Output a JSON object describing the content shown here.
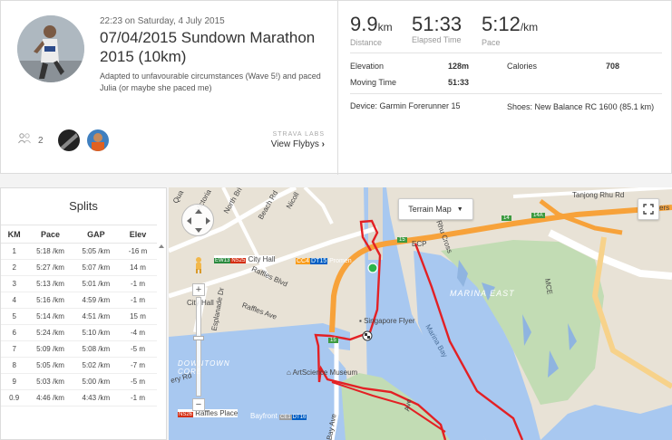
{
  "activity": {
    "timestamp": "22:23 on Saturday, 4 July 2015",
    "title": "07/04/2015 Sundown Marathon 2015 (10km)",
    "description": "Adapted to unfavourable circumstances (Wave 5!) and paced Julia (or maybe she paced me)"
  },
  "kudos": {
    "count": "2"
  },
  "flyby": {
    "lab_label": "STRAVA LABS",
    "link_label": "View Flybys"
  },
  "stats": {
    "distance": {
      "value": "9.9",
      "unit": "km",
      "label": "Distance"
    },
    "elapsed": {
      "value": "51:33",
      "label": "Elapsed Time"
    },
    "pace": {
      "value": "5:12",
      "unit": "/km",
      "label": "Pace"
    }
  },
  "details": {
    "elevation_label": "Elevation",
    "elevation_value": "128m",
    "calories_label": "Calories",
    "calories_value": "708",
    "moving_label": "Moving Time",
    "moving_value": "51:33",
    "device": "Device: Garmin Forerunner 15",
    "shoes": "Shoes: New Balance RC 1600 (85.1 km)"
  },
  "splits": {
    "title": "Splits",
    "headers": [
      "KM",
      "Pace",
      "GAP",
      "Elev"
    ],
    "rows": [
      [
        "1",
        "5:18 /km",
        "5:05 /km",
        "-16 m"
      ],
      [
        "2",
        "5:27 /km",
        "5:07 /km",
        "14 m"
      ],
      [
        "3",
        "5:13 /km",
        "5:01 /km",
        "-1 m"
      ],
      [
        "4",
        "5:16 /km",
        "4:59 /km",
        "-1 m"
      ],
      [
        "5",
        "5:14 /km",
        "4:51 /km",
        "15 m"
      ],
      [
        "6",
        "5:24 /km",
        "5:10 /km",
        "-4 m"
      ],
      [
        "7",
        "5:09 /km",
        "5:08 /km",
        "-5 m"
      ],
      [
        "8",
        "5:05 /km",
        "5:02 /km",
        "-7 m"
      ],
      [
        "9",
        "5:03 /km",
        "5:00 /km",
        "-5 m"
      ],
      [
        "0.9",
        "4:46 /km",
        "4:43 /km",
        "-1 m"
      ]
    ]
  },
  "map": {
    "map_type_label": "Terrain Map",
    "labels": {
      "city_hall_stn": "City Hall",
      "city_hall": "City Hall",
      "promenade": "Promen",
      "singapore_flyer": "Singapore Flyer",
      "marina_east": "MARINA EAST",
      "marina_bay": "Marina Bay",
      "art_museum": "ArtScience Museum",
      "downtown_core": "DOWNTOWN CORE",
      "raffles_place": "Raffles Place",
      "bayfront": "Bayfront",
      "raffles_blvd": "Raffles Blvd",
      "raffles_ave": "Raffles Ave",
      "esplanade_dr": "Esplanade Dr",
      "beach_rd": "Beach Rd",
      "rhu_cross": "Rhu Cross",
      "tanjong_rhu": "Tanjong Rhu Rd",
      "mce": "MCE",
      "ecp": "ECP",
      "nicoll": "Nicoll",
      "victoria": "Victoria",
      "north_bridge": "North Bri",
      "bay_ave": "Bay Ave",
      "ers": "ers",
      "quay": "Qua",
      "ery_rd": "ery Rd",
      "ave_suffix": "Ave",
      "stn_ns25": "NS25",
      "stn_ew13": "EW13",
      "stn_ns26": "NS26",
      "stn_cc4": "CC4",
      "stn_dt15": "DT15",
      "stn_ce1": "CE1",
      "stn_dt16": "DT16",
      "route_15": "15",
      "route_14": "14",
      "route_14a": "14A"
    }
  },
  "colors": {
    "accent": "#fc4c02",
    "route": "#e32024",
    "water": "#a8c8f0",
    "park": "#c2dcb4",
    "road": "#f7a23a"
  }
}
